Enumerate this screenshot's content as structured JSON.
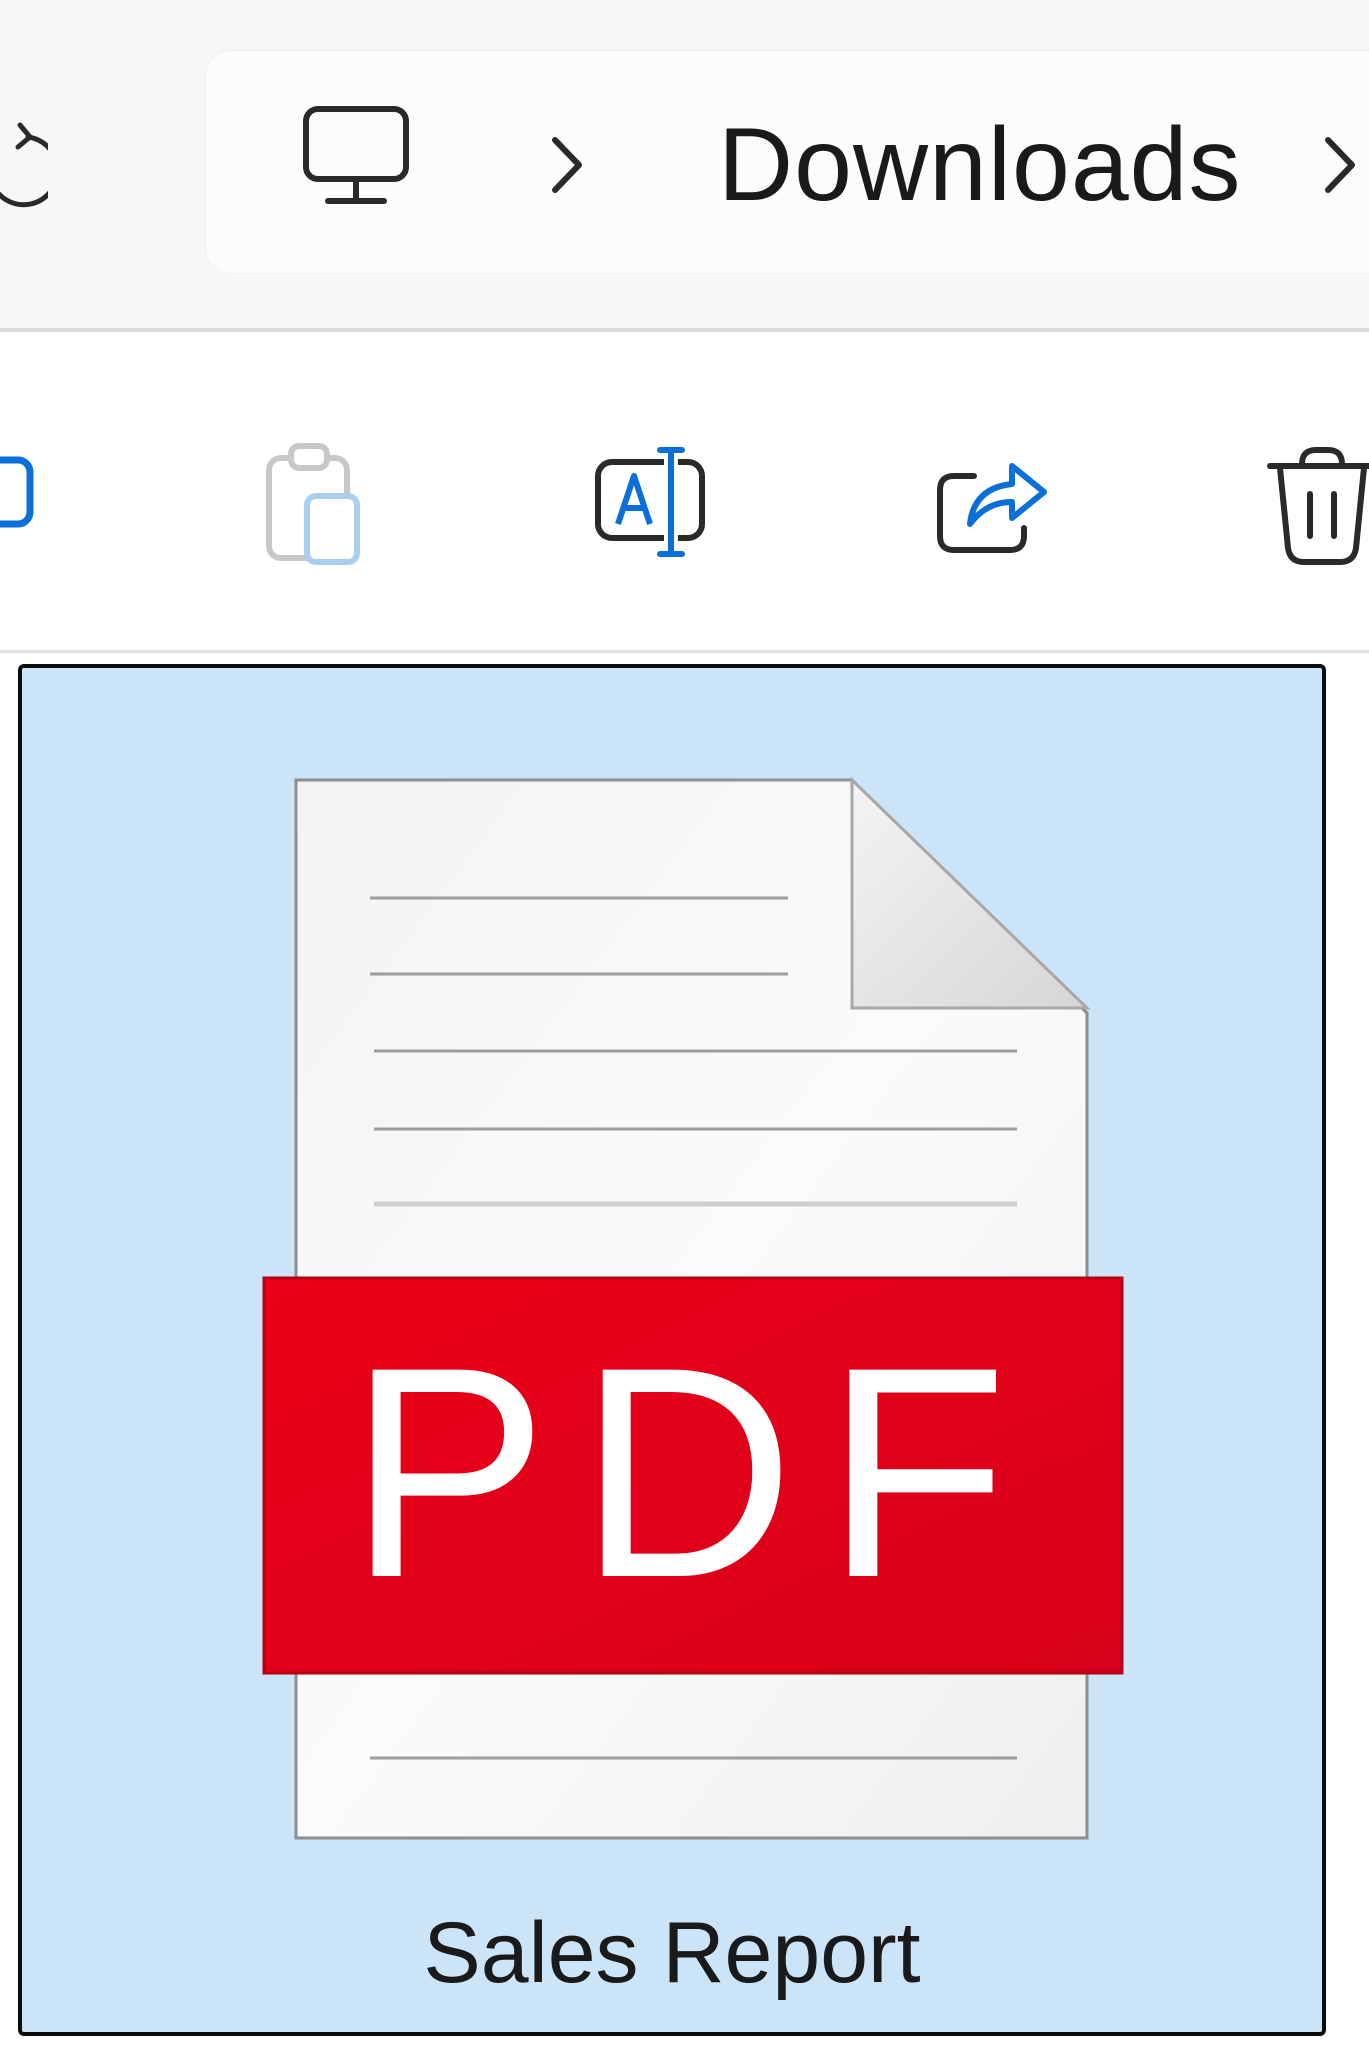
{
  "address_bar": {
    "location_icon": "this-pc-monitor-icon",
    "breadcrumbs": [
      "Downloads"
    ]
  },
  "command_bar": {
    "buttons": [
      {
        "icon": "copy-icon",
        "enabled": true
      },
      {
        "icon": "paste-icon",
        "enabled": false
      },
      {
        "icon": "rename-icon",
        "enabled": true
      },
      {
        "icon": "share-icon",
        "enabled": true
      },
      {
        "icon": "delete-icon",
        "enabled": true
      }
    ]
  },
  "files": [
    {
      "name": "Sales Report",
      "type_badge": "PDF",
      "icon": "pdf-file-icon",
      "selected": true
    }
  ],
  "colors": {
    "selection_background": "#cce4f7",
    "accent": "#0a6fd6",
    "pdf_badge": "#e5001a"
  }
}
